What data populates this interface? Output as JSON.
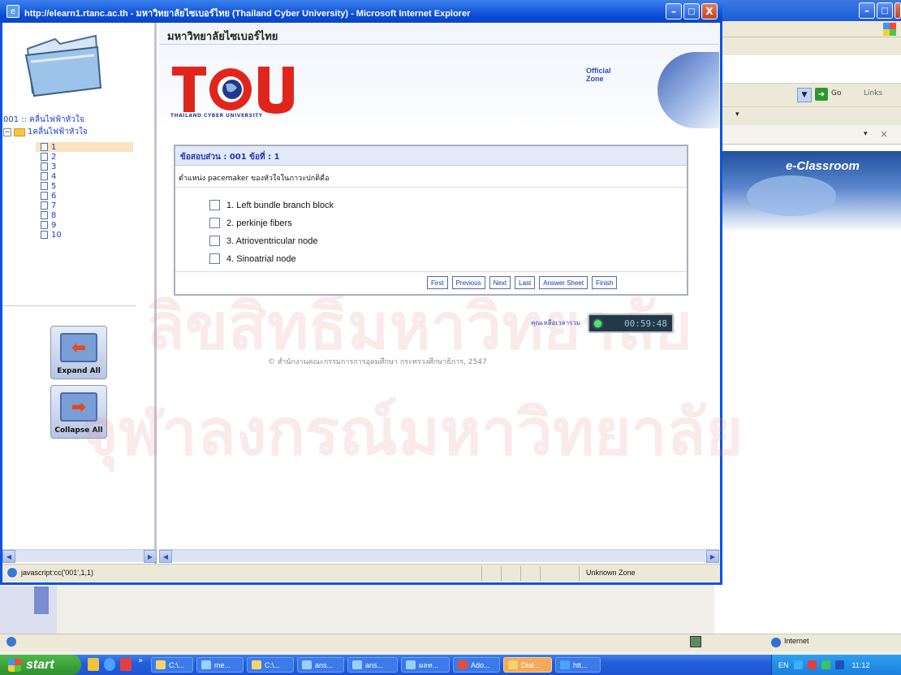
{
  "window": {
    "title": "http://elearn1.rtanc.ac.th - มหาวิทยาลัยไซเบอร์ไทย (Thailand Cyber University) - Microsoft Internet Explorer",
    "controls": {
      "minimize": "–",
      "maximize": "□",
      "close": "X"
    }
  },
  "background_window": {
    "go_label": "Go",
    "links_label": "Links",
    "banner_text": "e-Classroom"
  },
  "tree": {
    "root_label": "001 :: คลื่นไฟฟ้าหัวใจ",
    "folder_label": "1คลื่นไฟฟ้าหัวใจ",
    "items": [
      "1",
      "2",
      "3",
      "4",
      "5",
      "6",
      "7",
      "8",
      "9",
      "10"
    ],
    "selected_index": 0,
    "expand_label": "Expand All",
    "collapse_label": "Collapse All"
  },
  "header": {
    "university": "มหาวิทยาลัยไซเบอร์ไทย",
    "logo_text": "TCU",
    "logo_subtitle": "THAILAND CYBER UNIVERSITY",
    "official_line1": "Official",
    "official_line2": "Zone"
  },
  "quiz": {
    "header": "ข้อสอบส่วน : 001    ข้อที่ : 1",
    "question": "ตำแหน่ง pacemaker ของหัวใจในภาวะปกติคือ",
    "options": [
      "1.  Left bundle branch block",
      "2.  perkinje fibers",
      "3.  Atrioventricular node",
      "4.  Sinoatrial node"
    ],
    "nav": [
      "First",
      "Previous",
      "Next",
      "Last",
      "Answer Sheet",
      "Finish"
    ]
  },
  "timer": {
    "label": "คุณเหลือเวลารวม",
    "value": "00:59:48"
  },
  "copyright": "© สำนักงานคณะกรรมการการอุดมศึกษา กระทรวงศึกษาธิการ, 2547",
  "watermark": [
    "ลิขสิทธิ์มหาวิทยาลัย",
    "จุฬาลงกรณ์มหาวิทยาลัย"
  ],
  "statusbar": {
    "text": "javascript:cc('001',1,1)",
    "zone": "Unknown Zone"
  },
  "desktop_status": {
    "zone": "Internet"
  },
  "taskbar": {
    "start": "start",
    "buttons": [
      "C:\\...",
      "me...",
      "C:\\...",
      "ans...",
      "ans...",
      "ผลท...",
      "Ado...",
      "Dial...",
      "htt..."
    ],
    "tray_lang": "EN",
    "clock": "11:12"
  },
  "colors": {
    "accent": "#0a54e0",
    "link": "#1d37b5",
    "timer_bg": "#233a46"
  }
}
